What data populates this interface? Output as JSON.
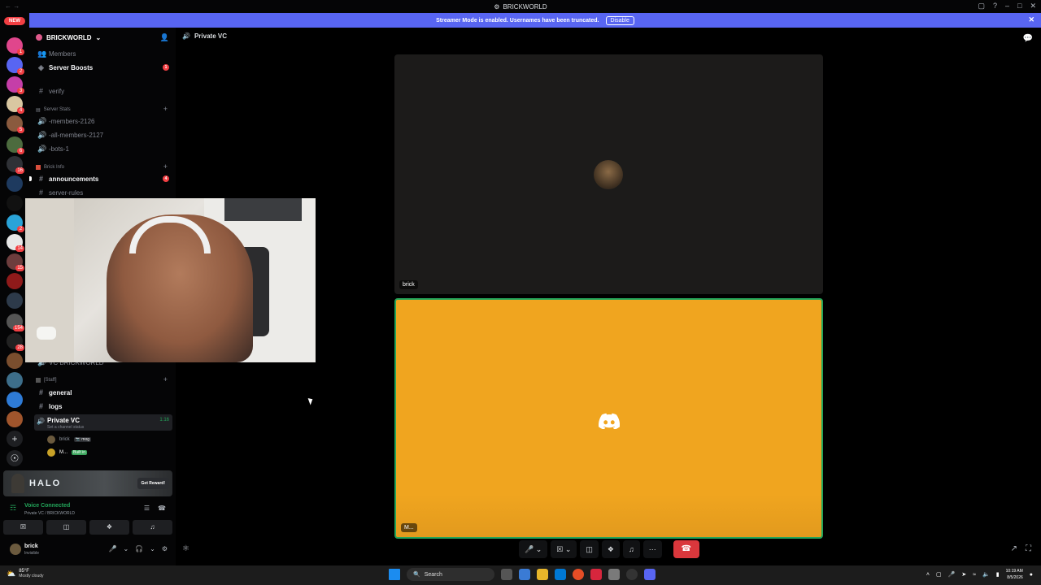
{
  "window": {
    "title": "BRICKWORLD"
  },
  "banner": {
    "message": "Streamer Mode is enabled. Usernames have been truncated.",
    "disable_label": "Disable"
  },
  "rail": {
    "new_label": "NEW",
    "badges": [
      "1",
      "2",
      "3",
      "4",
      "5",
      "6",
      "16",
      "2",
      "14",
      "15",
      "154",
      "28"
    ]
  },
  "sidebar": {
    "server_name": "BRICKWORLD",
    "members": "Members",
    "server_boosts": "Server Boosts",
    "boost_badge": "1",
    "verify": "verify",
    "cat_stats": "Server Stats",
    "members_ch": "-members-2126",
    "all_members_ch": "-all-members-2127",
    "bots_ch": "-bots-1",
    "cat_info": "Brick Info",
    "announcements": "announcements",
    "ann_badge": "4",
    "server_rules": "server-rules",
    "cut_label": "VC BRICKWORLD",
    "cat_staff": "[Staff]",
    "general": "general",
    "logs": "logs",
    "vc_name": "Private VC",
    "vc_status": "Set a channel status",
    "vc_timer": "1:16",
    "vc_user1": "brick",
    "vc_user1_tag": "📷 mog",
    "vc_user2": "M...",
    "vc_user2_tag": "Built in"
  },
  "promo": {
    "game": "HALO",
    "button": "Get Reward!"
  },
  "voice": {
    "status": "Voice Connected",
    "sub": "Private VC / BRICKWORLD"
  },
  "user": {
    "name": "brick",
    "status": "Invisible"
  },
  "call": {
    "channel": "Private VC",
    "tile1_name": "brick",
    "tile2_name": "M..."
  },
  "taskbar": {
    "temp": "85°F",
    "weather": "Mostly cloudy",
    "search": "Search",
    "time": "10:19 AM",
    "date": "8/5/2026"
  },
  "colors": {
    "accent": "#5865f2",
    "speaking": "#23a55a",
    "tile_bg": "#f0a51f",
    "end_call": "#da373c"
  }
}
